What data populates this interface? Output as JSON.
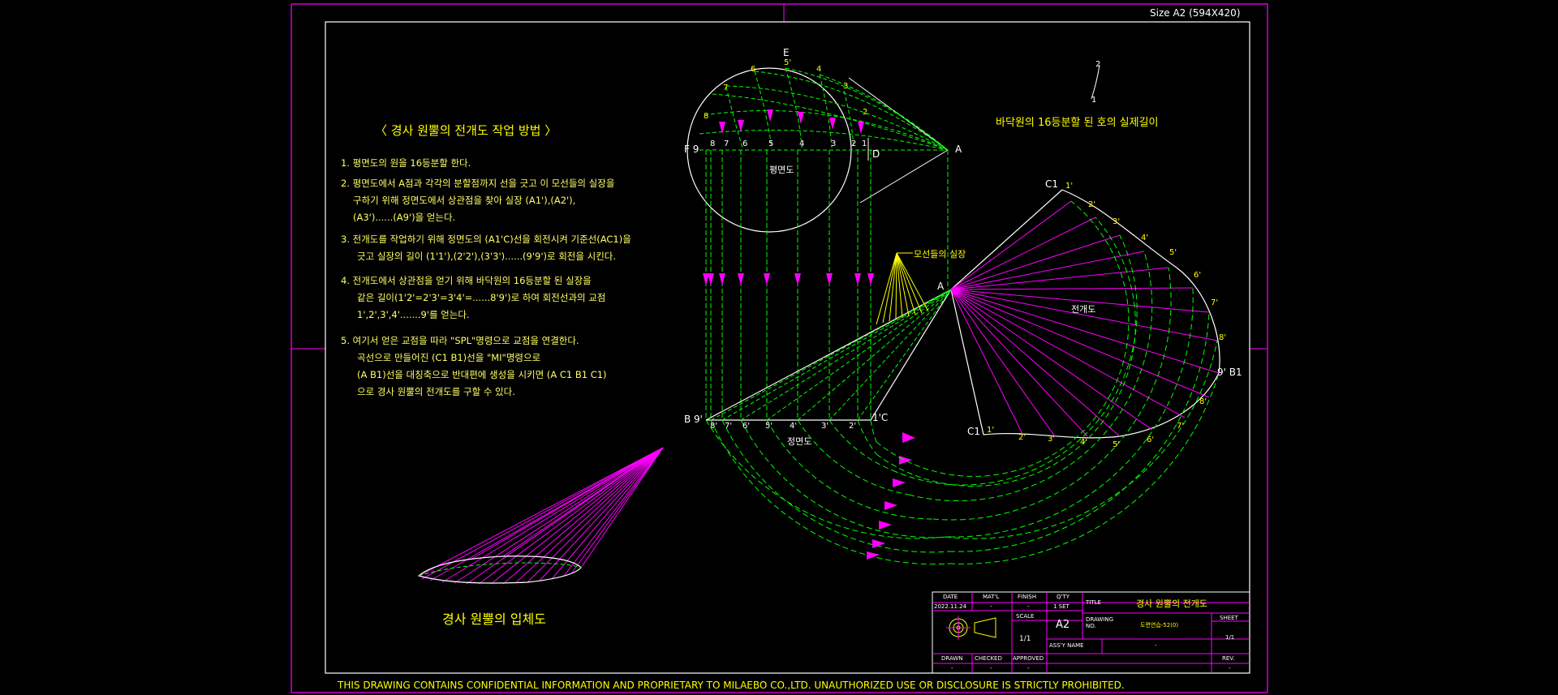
{
  "sheet": {
    "size_label": "Size A2 (594X420)",
    "footer": "THIS DRAWING CONTAINS CONFIDENTIAL INFORMATION AND PROPRIETARY TO MILAEBO CO.,LTD. UNAUTHORIZED USE OR DISCLOSURE IS STRICTLY PROHIBITED.",
    "colors": {
      "border": "#ff00ff",
      "frame": "#ffffff",
      "green": "#00ff00",
      "magenta": "#ff00ff",
      "yellow": "#ffff00",
      "background": "#000000"
    }
  },
  "method": {
    "heading": "〈 경사 원뿔의 전개도 작업 방법 〉",
    "steps": [
      "1. 평면도의 원을 16등분할 한다.",
      "2. 평면도에서 A점과 각각의 분할점까지 선을 긋고 이 모선들의 실장을",
      "구하기 위해 정면도에서 상관점을 찾아 실장 (A1'),(A2'),",
      "(A3')......(A9')을 얻는다.",
      "3. 전개도를 작업하기 위해 정면도의 (A1'C)선을 회전시켜 기준선(AC1)을",
      "긋고 실장의 길이 (1'1'),(2'2'),(3'3')......(9'9')로 회전을 시킨다.",
      "4. 전개도에서 상관점을 얻기 위해 바닥원의 16등분할 된 실장을",
      "같은 길이(1'2'=2'3'=3'4'=......8'9')로 하여 회전선과의 교점",
      "1',2',3',4'.......9'를 얻는다.",
      "5. 여기서 얻은 교점을 따라 \"SPL\"명령으로 교점을 연결한다.",
      "곡선으로 만들어진 (C1 B1)선을  \"MI\"명령으로",
      "(A B1)선을 대칭축으로 반대편에 생성을 시키면 (A C1 B1 C1)",
      "으로 경사 원뿔의 전개도를 구할 수 있다."
    ]
  },
  "labels": {
    "plan_view": "평면도",
    "front_view": "정면도",
    "development": "전개도",
    "true_length": "모선들의 실장",
    "arc_note": "바닥원의 16등분할 된 호의 실제길이",
    "iso_title": "경사 원뿔의 입체도",
    "E": "E",
    "F9": "F 9",
    "D": "D",
    "A_top": "A",
    "A_mid": "A",
    "B9": "B 9'",
    "C": "1'C",
    "C1_top": "C1",
    "C1_bot": "C1",
    "B1": "9' B1",
    "arc_pt_1": "1",
    "arc_pt_2": "2"
  },
  "plan_points": [
    "1",
    "2",
    "3",
    "4",
    "5",
    "6",
    "7",
    "8",
    "9"
  ],
  "plan_circle_points": [
    "8",
    "7",
    "6",
    "5'",
    "4",
    "3",
    "2"
  ],
  "front_points": [
    "8'",
    "7'",
    "6'",
    "5'",
    "4'",
    "3'",
    "2'"
  ],
  "dev_points_upper": [
    "1'",
    "2'",
    "3'",
    "4'",
    "5'",
    "6'",
    "7'",
    "8'"
  ],
  "dev_points_lower": [
    "1'",
    "2'",
    "3'",
    "4'",
    "5'",
    "6'",
    "7'",
    "8'"
  ],
  "title_block": {
    "date_h": "DATE",
    "date_v": "2022.11.24",
    "matl_h": "MAT'L",
    "matl_v": "-",
    "finish_h": "FINISH",
    "finish_v": "-",
    "qty_h": "Q'TY",
    "qty_v": "1 SET",
    "title_h": "TITLE",
    "title_v": "경사 원뿔의 전개도",
    "scale_h": "SCALE",
    "scale_v": "1/1",
    "size_v": "A2",
    "drawing_h": "DRAWING NO.",
    "drawing_v": "도면연습-52(0)",
    "sheet_h": "SHEET",
    "sheet_v": "1/1",
    "assy_h": "ASS'Y NAME",
    "assy_v": "-",
    "drawn_h": "DRAWN",
    "drawn_v": "-",
    "checked_h": "CHECKED",
    "checked_v": "-",
    "approved_h": "APPROVED",
    "approved_v": "-",
    "rev_h": "REV.",
    "rev_v": "-"
  }
}
